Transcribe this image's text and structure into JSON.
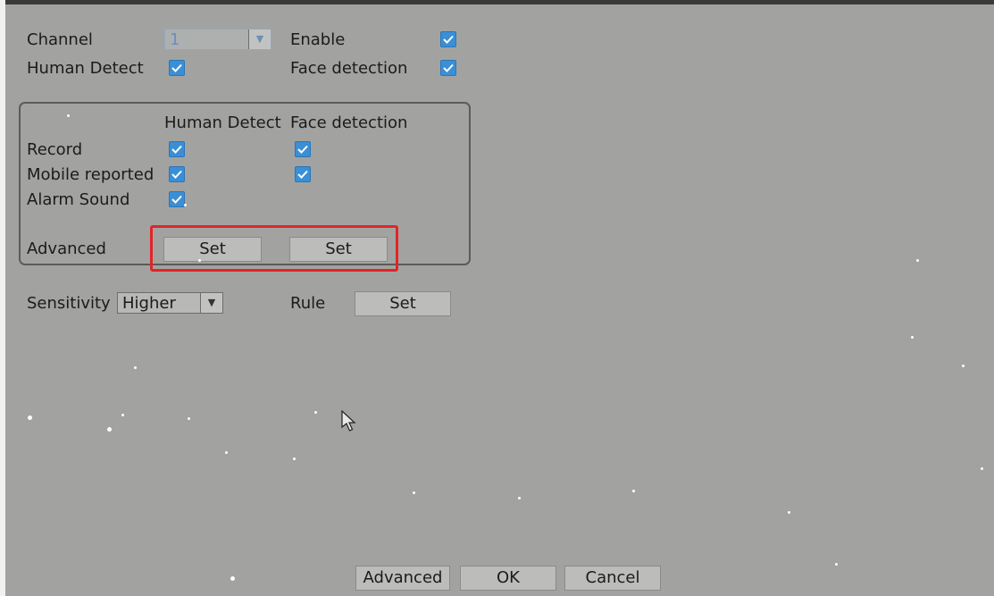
{
  "form": {
    "channel_label": "Channel",
    "channel_value": "1",
    "enable_label": "Enable",
    "human_detect_label": "Human Detect",
    "face_detection_label": "Face detection"
  },
  "group": {
    "col_human": "Human Detect",
    "col_face": "Face detection",
    "record_label": "Record",
    "mobile_label": "Mobile reported",
    "alarm_label": "Alarm Sound",
    "advanced_label": "Advanced",
    "set_human": "Set",
    "set_face": "Set"
  },
  "sensitivity": {
    "label": "Sensitivity",
    "value": "Higher",
    "rule_label": "Rule",
    "rule_set": "Set"
  },
  "footer": {
    "advanced": "Advanced",
    "ok": "OK",
    "cancel": "Cancel"
  },
  "icons": {
    "checkbox": "checked-checkbox-icon",
    "dropdown": "chevron-down-icon",
    "cursor": "mouse-pointer-icon"
  },
  "colors": {
    "background": "#a2a3a0",
    "checkbox": "#3a8fd6",
    "highlight": "#e2242a"
  },
  "checkboxes_checked": {
    "enable": true,
    "human_detect": true,
    "face_detection": true,
    "record_human": true,
    "record_face": true,
    "mobile_human": true,
    "mobile_face": true,
    "alarm_human": true
  }
}
